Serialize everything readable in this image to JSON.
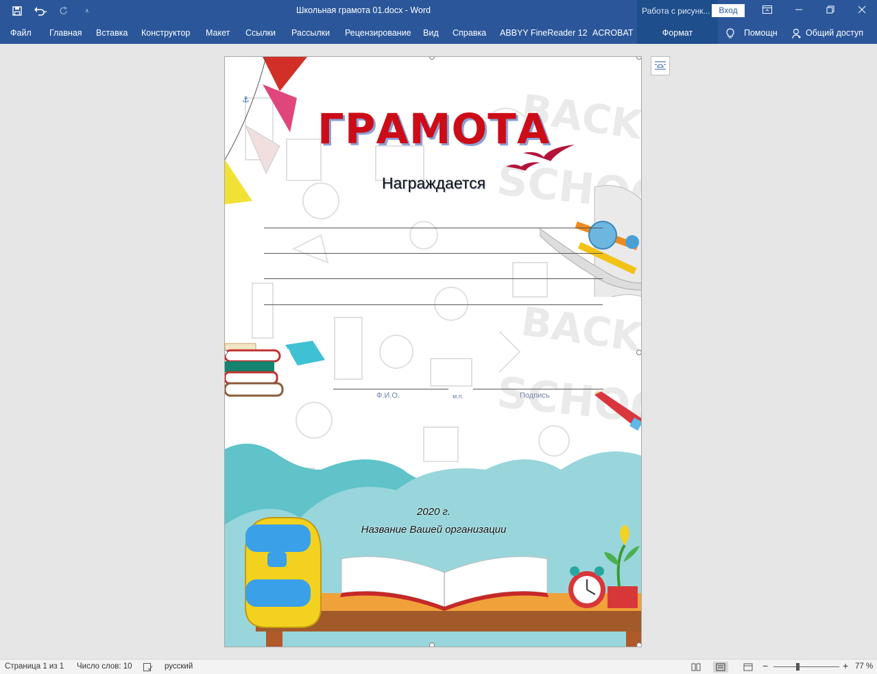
{
  "titlebar": {
    "doc_title": "Школьная грамота 01.docx  -  Word",
    "context_title": "Работа с рисунк...",
    "login_label": "Вход"
  },
  "ribbon": {
    "tabs": [
      "Файл",
      "Главная",
      "Вставка",
      "Конструктор",
      "Макет",
      "Ссылки",
      "Рассылки",
      "Рецензирование",
      "Вид",
      "Справка",
      "ABBYY FineReader 12",
      "ACROBAT"
    ],
    "format_tab": "Формат",
    "help_label": "Помощн",
    "share_label": "Общий доступ"
  },
  "document": {
    "title": "ГРАМОТА",
    "awarded": "Награждается",
    "fio_label": "Ф.И.О.",
    "initials_label": "м.п.",
    "signature_label": "Подпись",
    "year": "2020 г.",
    "organization": "Название Вашей организации",
    "watermark_text": "BACK to SCHOOL"
  },
  "statusbar": {
    "page_info": "Страница 1 из 1",
    "word_count": "Число слов: 10",
    "language": "русский",
    "zoom": "77 %"
  },
  "colors": {
    "word_blue": "#2b579a",
    "title_red": "#cc0d17",
    "wave_teal": "#5fc3c9"
  }
}
